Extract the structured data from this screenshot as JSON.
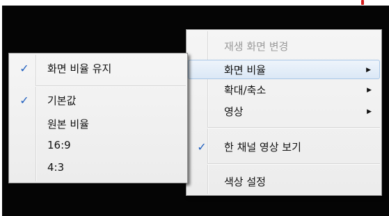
{
  "main_menu": {
    "items": [
      {
        "label": "재생 화면 변경",
        "disabled": true
      },
      {
        "label": "화면 비율",
        "submenu_arrow": "▶"
      },
      {
        "label": "확대/축소",
        "submenu_arrow": "▶"
      },
      {
        "label": "영상",
        "submenu_arrow": "▶"
      },
      {
        "label": "한 채널 영상 보기",
        "check": "✓"
      },
      {
        "label": "색상 설정"
      }
    ]
  },
  "sub_menu": {
    "items": [
      {
        "label": "화면 비율 유지",
        "check": "✓"
      },
      {
        "label": "기본값",
        "check": "✓"
      },
      {
        "label": "원본 비율"
      },
      {
        "label": "16:9"
      },
      {
        "label": "4:3"
      }
    ]
  },
  "colors": {
    "screen_bg": "#050505",
    "menu_bg": "#f0f0f0",
    "check_color": "#1f5fbf",
    "highlight_bg": "#dbe8f6",
    "red_marker": "#d41c1c"
  }
}
